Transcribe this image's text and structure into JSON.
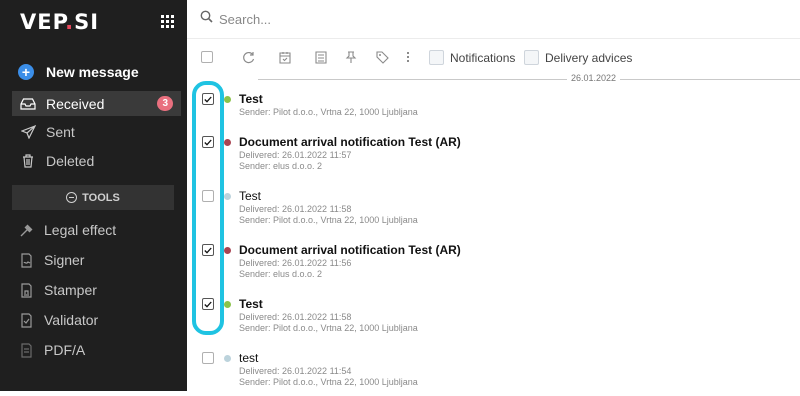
{
  "app": {
    "logo_text": "VEP",
    "logo_dot": ".",
    "logo_end": "SI"
  },
  "sidebar": {
    "new_message": "New message",
    "nav": [
      {
        "label": "Received",
        "badge": "3",
        "icon": "inbox-icon"
      },
      {
        "label": "Sent",
        "icon": "send-icon"
      },
      {
        "label": "Deleted",
        "icon": "trash-icon"
      }
    ],
    "tools_label": "TOOLS",
    "tools": [
      {
        "label": "Legal effect",
        "icon": "gavel-icon"
      },
      {
        "label": "Signer",
        "icon": "signature-icon"
      },
      {
        "label": "Stamper",
        "icon": "stamp-icon"
      },
      {
        "label": "Validator",
        "icon": "document-check-icon"
      },
      {
        "label": "PDF/A",
        "icon": "pdf-icon"
      }
    ]
  },
  "search": {
    "placeholder": "Search..."
  },
  "toolbar": {
    "filters": [
      "Notifications",
      "Delivery advices"
    ]
  },
  "date_separator": "26.01.2022",
  "messages": [
    {
      "title": "Test",
      "lines": [
        "Sender: Pilot d.o.o., Vrtna 22, 1000 Ljubljana"
      ],
      "checked": true,
      "bold": true,
      "dot_color": "#8bc34a"
    },
    {
      "title": "Document arrival notification Test (AR)",
      "lines": [
        "Delivered: 26.01.2022 11:57",
        "Sender: elus d.o.o. 2"
      ],
      "checked": true,
      "bold": true,
      "dot_color": "#a94452"
    },
    {
      "title": "Test",
      "lines": [
        "Delivered: 26.01.2022 11:58",
        "Sender: Pilot d.o.o., Vrtna 22, 1000 Ljubljana"
      ],
      "checked": false,
      "bold": false,
      "dot_color": "#bcd3dc"
    },
    {
      "title": "Document arrival notification Test (AR)",
      "lines": [
        "Delivered: 26.01.2022 11:56",
        "Sender: elus d.o.o. 2"
      ],
      "checked": true,
      "bold": true,
      "dot_color": "#a94452"
    },
    {
      "title": "Test",
      "lines": [
        "Delivered: 26.01.2022 11:58",
        "Sender: Pilot d.o.o., Vrtna 22, 1000 Ljubljana"
      ],
      "checked": true,
      "bold": true,
      "dot_color": "#8bc34a"
    },
    {
      "title": "test",
      "lines": [
        "Delivered: 26.01.2022 11:54",
        "Sender: Pilot d.o.o., Vrtna 22, 1000 Ljubljana"
      ],
      "checked": false,
      "bold": false,
      "dot_color": "#bcd3dc"
    }
  ],
  "colors": {
    "sidebar_bg": "#1f1f1f",
    "accent_badge": "#e9707f",
    "highlight": "#1fc3e2",
    "new_message_icon": "#3b8ee8"
  }
}
